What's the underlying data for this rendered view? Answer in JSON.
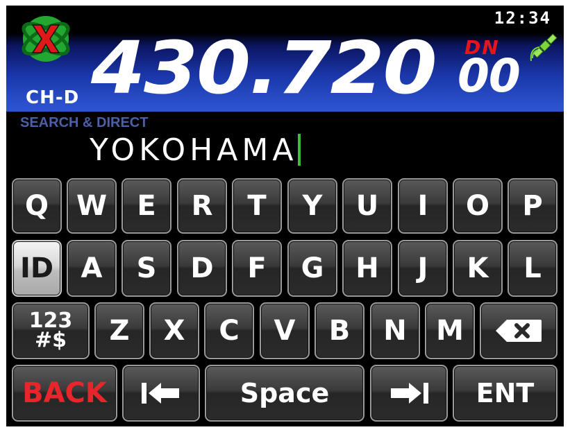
{
  "status": {
    "clock": "12:34",
    "mode_badge": "DN",
    "channel": "CH-D"
  },
  "frequency": {
    "main": "430.720",
    "sub": "00"
  },
  "search": {
    "label": "SEARCH & DIRECT",
    "value": "YOKOHAMA"
  },
  "keyboard": {
    "row1": [
      "Q",
      "W",
      "E",
      "R",
      "T",
      "Y",
      "U",
      "I",
      "O",
      "P"
    ],
    "row2": [
      "A",
      "S",
      "D",
      "F",
      "G",
      "H",
      "J",
      "K",
      "L"
    ],
    "row3": [
      "Z",
      "X",
      "C",
      "V",
      "B",
      "N",
      "M"
    ],
    "id_key": "ID",
    "num_key_top": "123",
    "num_key_bottom": "#$",
    "back": "BACK",
    "space": "Space",
    "enter": "ENT"
  },
  "colors": {
    "header_blue": "#2a4fcb",
    "dn_red": "#e8141c",
    "cursor_green": "#35c23a",
    "label_blue": "#4d5fa8"
  },
  "icons": {
    "logo": "x-logo-icon",
    "gps": "gps-satellite-icon",
    "backspace": "backspace-icon",
    "cursor_left": "cursor-left-icon",
    "cursor_right": "cursor-right-icon"
  }
}
